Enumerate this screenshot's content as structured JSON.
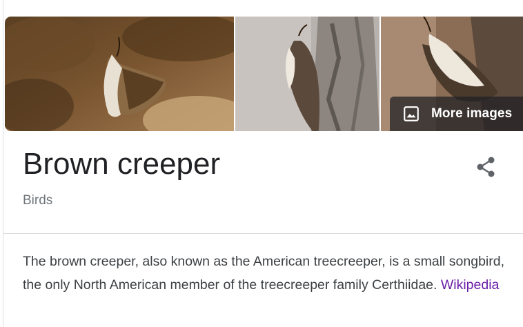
{
  "panel": {
    "title": "Brown creeper",
    "subtitle": "Birds",
    "more_images_label": "More images",
    "description": "The brown creeper, also known as the American treecreeper, is a small songbird, the only North American member of the treecreeper family Certhiidae.",
    "source_link": "Wikipedia"
  },
  "icons": {
    "more_images": "image-icon",
    "share": "share-icon"
  },
  "colors": {
    "title": "#202124",
    "subtitle": "#70757a",
    "link_visited": "#681da8",
    "overlay": "#202124"
  }
}
